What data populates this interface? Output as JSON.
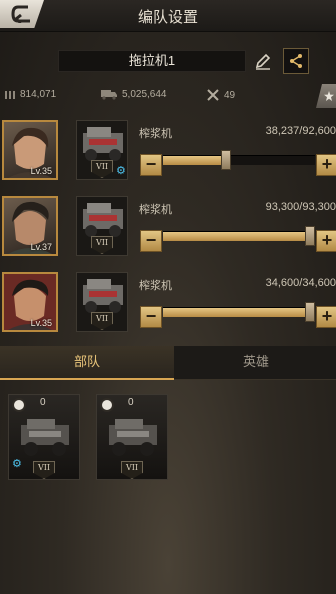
{
  "header": {
    "title": "编队设置"
  },
  "formation": {
    "name": "拖拉机1"
  },
  "stats": {
    "troops": "814,071",
    "load": "5,025,644",
    "repair": "49"
  },
  "units": [
    {
      "level": "Lv.35",
      "rank": "VII",
      "vehicle_name": "榨浆机",
      "count": "38,237/92,600",
      "fill": 0.413,
      "gear": true
    },
    {
      "level": "Lv.37",
      "rank": "VII",
      "vehicle_name": "榨浆机",
      "count": "93,300/93,300",
      "fill": 1.0,
      "gear": false
    },
    {
      "level": "Lv.35",
      "rank": "VII",
      "vehicle_name": "榨浆机",
      "count": "34,600/34,600",
      "fill": 1.0,
      "gear": false
    }
  ],
  "tabs": [
    {
      "label": "部队",
      "active": true
    },
    {
      "label": "英雄",
      "active": false
    }
  ],
  "troop_cards": [
    {
      "qty": "0",
      "rank": "VII",
      "gear": true
    },
    {
      "qty": "0",
      "rank": "VII",
      "gear": false
    }
  ],
  "colors": {
    "accent": "#d8a653",
    "gear": "#4ec3ee"
  }
}
